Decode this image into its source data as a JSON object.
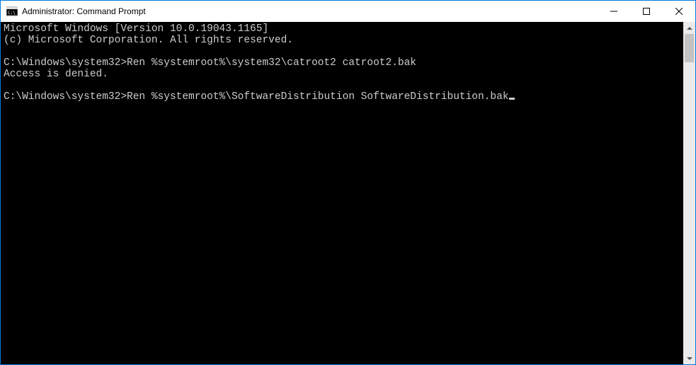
{
  "titlebar": {
    "title": "Administrator: Command Prompt"
  },
  "console": {
    "line1": "Microsoft Windows [Version 10.0.19043.1165]",
    "line2": "(c) Microsoft Corporation. All rights reserved.",
    "blank1": "",
    "prompt1_path": "C:\\Windows\\system32>",
    "prompt1_cmd": "Ren %systemroot%\\system32\\catroot2 catroot2.bak",
    "response1": "Access is denied.",
    "blank2": "",
    "prompt2_path": "C:\\Windows\\system32>",
    "prompt2_cmd": "Ren %systemroot%\\SoftwareDistribution SoftwareDistribution.bak"
  }
}
